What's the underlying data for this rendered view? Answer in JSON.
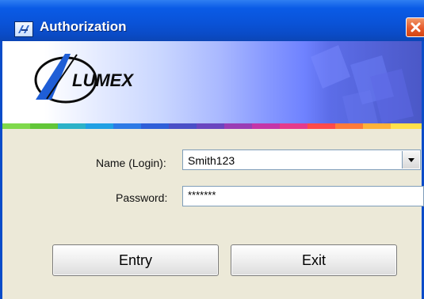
{
  "window": {
    "title": "Authorization",
    "icon": "app-icon",
    "close_icon": "close-icon"
  },
  "banner": {
    "logo_text": "LUMEX",
    "strip_colors": [
      "#7fd94b",
      "#62c638",
      "#2cb2c8",
      "#20a0e4",
      "#2d7ae6",
      "#2f5fd9",
      "#4a4fc7",
      "#6a46c0",
      "#9a3db5",
      "#c436a8",
      "#e53a8b",
      "#ff4a4a",
      "#ff7a3a",
      "#ffb23a",
      "#ffe04a"
    ]
  },
  "form": {
    "name_label": "Name (Login):",
    "name_value": "Smith123",
    "password_label": "Password:",
    "password_value": "*******"
  },
  "buttons": {
    "entry_label": "Entry",
    "exit_label": "Exit"
  }
}
